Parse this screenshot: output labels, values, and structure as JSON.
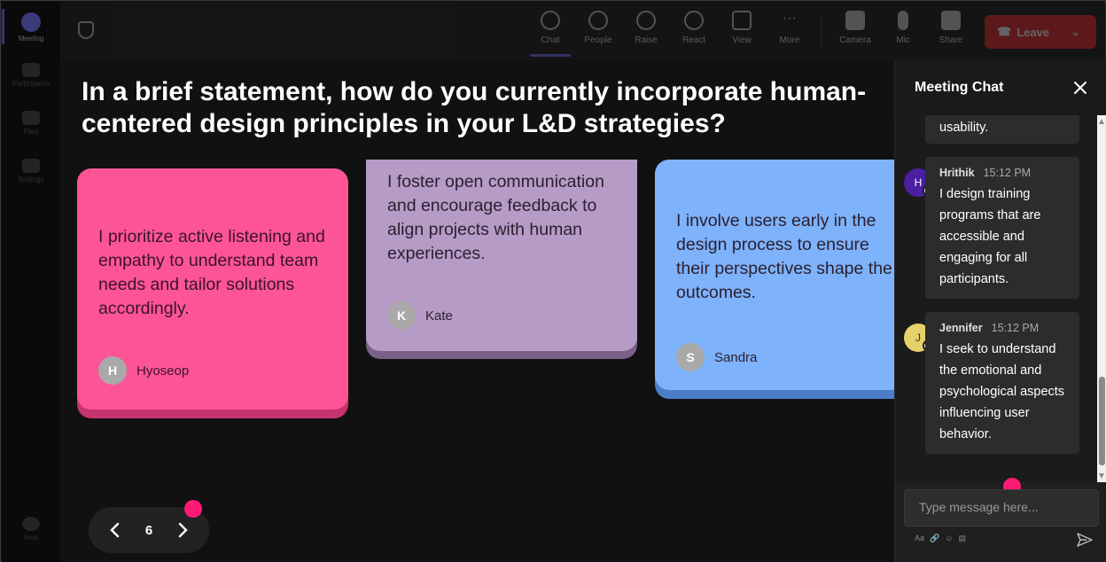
{
  "rail": {
    "items": [
      {
        "label": "Meeting",
        "icon": "meeting-icon"
      },
      {
        "label": "Participants",
        "icon": "participants-icon"
      },
      {
        "label": "Files",
        "icon": "files-icon"
      },
      {
        "label": "Settings",
        "icon": "settings-icon"
      }
    ],
    "help": {
      "label": "Help",
      "icon": "help-icon"
    }
  },
  "topbar": {
    "items": [
      {
        "label": "Chat",
        "icon": "chat-icon"
      },
      {
        "label": "People",
        "icon": "people-icon"
      },
      {
        "label": "Raise",
        "icon": "raise-hand-icon"
      },
      {
        "label": "React",
        "icon": "react-icon"
      },
      {
        "label": "View",
        "icon": "view-icon"
      },
      {
        "label": "More",
        "icon": "more-icon"
      },
      {
        "label": "Camera",
        "icon": "camera-icon"
      },
      {
        "label": "Mic",
        "icon": "mic-icon"
      },
      {
        "label": "Share",
        "icon": "share-icon"
      }
    ],
    "leave_label": "Leave"
  },
  "stage": {
    "question": "In a brief statement, how do you currently incorporate human-centered design principles in your L&D strategies?",
    "cards": [
      {
        "text": "I prioritize active listening and empathy to understand team needs and tailor solutions accordingly.",
        "initial": "H",
        "author": "Hyoseop",
        "color": "#fd5497"
      },
      {
        "text": "I foster open communication and encourage feedback to align projects with human experiences.",
        "initial": "K",
        "author": "Kate",
        "color": "#b69bc6"
      },
      {
        "text": "I involve users early in the design process to ensure their perspectives shape the outcomes.",
        "initial": "S",
        "author": "Sandra",
        "color": "#7eb2fa"
      }
    ],
    "pager": {
      "prev": "‹",
      "page": "6",
      "next": "›"
    }
  },
  "chat": {
    "title": "Meeting Chat",
    "close": "×",
    "messages": [
      {
        "name": "",
        "time": "",
        "initial": "",
        "text": "usability."
      },
      {
        "name": "Hrithik",
        "time": "15:12 PM",
        "initial": "H",
        "avatar_color": "#4b1fa0",
        "text": "I design training programs that are accessible and engaging for all participants."
      },
      {
        "name": "Jennifer",
        "time": "15:12 PM",
        "initial": "J",
        "avatar_color": "#e6d16a",
        "text": "I seek to understand the emotional and psychological aspects influencing user behavior."
      }
    ],
    "input_placeholder": "Type message here...",
    "toolbar": [
      "Aa",
      "🔗",
      "☺",
      "▤"
    ]
  },
  "accent": "#ff1a75"
}
